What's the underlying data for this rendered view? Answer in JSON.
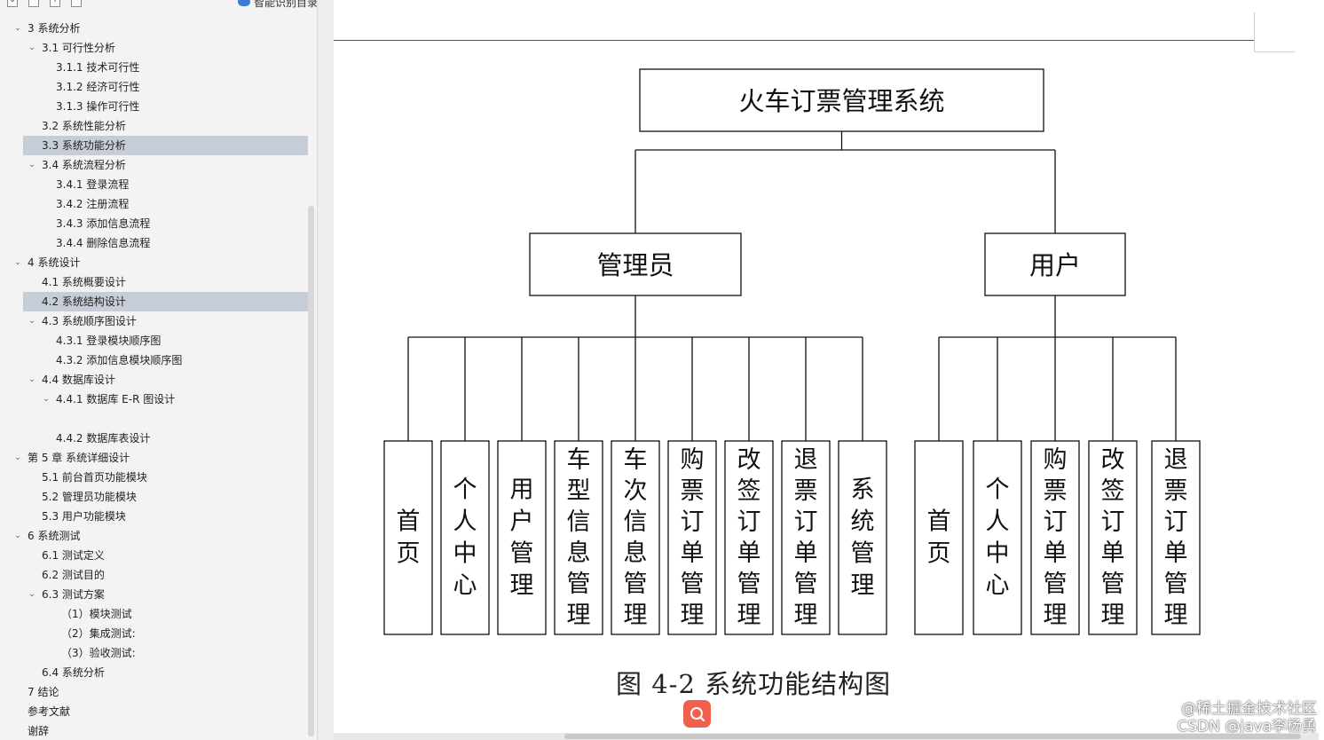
{
  "nav": {
    "toolbar": {
      "collapse_glyph": "⌄",
      "expand_glyph": "⌃",
      "add_glyph": "+",
      "remove_glyph": "−",
      "smart_toc_label": "智能识别目录"
    },
    "outline": [
      {
        "label": "3  系统分析",
        "twisty": "⌄",
        "level": 0,
        "selected": false
      },
      {
        "label": "3.1  可行性分析",
        "twisty": "⌄",
        "level": 1,
        "selected": false
      },
      {
        "label": "3.1.1  技术可行性",
        "twisty": "",
        "level": 2,
        "selected": false
      },
      {
        "label": "3.1.2 经济可行性",
        "twisty": "",
        "level": 2,
        "selected": false
      },
      {
        "label": "3.1.3 操作可行性",
        "twisty": "",
        "level": 2,
        "selected": false
      },
      {
        "label": "3.2  系统性能分析",
        "twisty": "",
        "level": 1,
        "selected": false
      },
      {
        "label": "3.3  系统功能分析",
        "twisty": "",
        "level": 1,
        "selected": true
      },
      {
        "label": "3.4 系统流程分析",
        "twisty": "⌄",
        "level": 1,
        "selected": false
      },
      {
        "label": "3.4.1 登录流程",
        "twisty": "",
        "level": 2,
        "selected": false
      },
      {
        "label": "3.4.2 注册流程",
        "twisty": "",
        "level": 2,
        "selected": false
      },
      {
        "label": "3.4.3 添加信息流程",
        "twisty": "",
        "level": 2,
        "selected": false
      },
      {
        "label": "3.4.4 删除信息流程",
        "twisty": "",
        "level": 2,
        "selected": false
      },
      {
        "label": "4    系统设计",
        "twisty": "⌄",
        "level": 0,
        "selected": false
      },
      {
        "label": "4.1 系统概要设计",
        "twisty": "",
        "level": 1,
        "selected": false
      },
      {
        "label": "4.2 系统结构设计",
        "twisty": "",
        "level": 1,
        "selected": true
      },
      {
        "label": "4.3 系统顺序图设计",
        "twisty": "⌄",
        "level": 1,
        "selected": false
      },
      {
        "label": "4.3.1 登录模块顺序图",
        "twisty": "",
        "level": 2,
        "selected": false
      },
      {
        "label": "4.3.2 添加信息模块顺序图",
        "twisty": "",
        "level": 2,
        "selected": false
      },
      {
        "label": "4.4 数据库设计",
        "twisty": "⌄",
        "level": 1,
        "selected": false
      },
      {
        "label": "4.4.1 数据库 E-R 图设计",
        "twisty": "⌄",
        "level": 2,
        "selected": false
      },
      {
        "label": "",
        "twisty": "",
        "level": 2,
        "selected": false
      },
      {
        "label": "4.4.2 数据库表设计",
        "twisty": "",
        "level": 2,
        "selected": false
      },
      {
        "label": "第 5 章  系统详细设计",
        "twisty": "⌄",
        "level": 0,
        "selected": false
      },
      {
        "label": "5.1 前台首页功能模块",
        "twisty": "",
        "level": 1,
        "selected": false
      },
      {
        "label": "5.2 管理员功能模块",
        "twisty": "",
        "level": 1,
        "selected": false
      },
      {
        "label": "5.3 用户功能模块",
        "twisty": "",
        "level": 1,
        "selected": false
      },
      {
        "label": "6  系统测试",
        "twisty": "⌄",
        "level": 0,
        "selected": false
      },
      {
        "label": "6.1  测试定义",
        "twisty": "",
        "level": 1,
        "selected": false
      },
      {
        "label": "6.2  测试目的",
        "twisty": "",
        "level": 1,
        "selected": false
      },
      {
        "label": "6.3 测试方案",
        "twisty": "⌄",
        "level": 1,
        "selected": false
      },
      {
        "label": "（1）模块测试",
        "twisty": "",
        "level": 3,
        "selected": false
      },
      {
        "label": "（2）集成测试:",
        "twisty": "",
        "level": 3,
        "selected": false
      },
      {
        "label": "（3）验收测试:",
        "twisty": "",
        "level": 3,
        "selected": false
      },
      {
        "label": "6.4 系统分析",
        "twisty": "",
        "level": 1,
        "selected": false
      },
      {
        "label": "7  结论",
        "twisty": "",
        "level": 0,
        "selected": false
      },
      {
        "label": "参考文献",
        "twisty": "",
        "level": 0,
        "selected": false
      },
      {
        "label": "谢辞",
        "twisty": "",
        "level": 0,
        "selected": false
      }
    ]
  },
  "diagram": {
    "root": "火车订票管理系统",
    "groups": [
      {
        "label": "管理员",
        "children": [
          "首页",
          "个人中心",
          "用户管理",
          "车型信息管理",
          "车次信息管理",
          "购票订单管理",
          "改签订单管理",
          "退票订单管理",
          "系统管理"
        ]
      },
      {
        "label": "用户",
        "children": [
          "首页",
          "个人中心",
          "购票订单管理",
          "改签订单管理",
          "退票订单管理"
        ]
      }
    ],
    "caption": "图 4-2  系统功能结构图"
  },
  "watermark": {
    "line1": "@稀土掘金技术社区",
    "line2": "CSDN @java李杨勇"
  },
  "colors": {
    "nav_bg": "#f3f3f3",
    "selected_row": "#c6cdd6",
    "search_button": "#f0604c"
  },
  "icons": {
    "search": "search-icon",
    "smart_toc": "smart-toc-icon"
  }
}
